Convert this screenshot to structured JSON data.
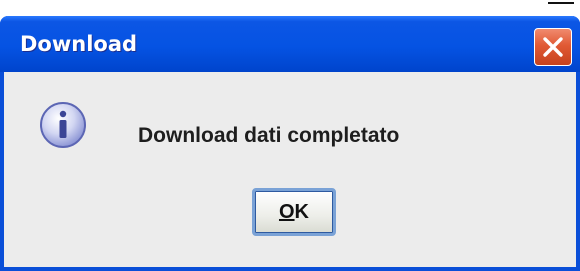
{
  "window": {
    "title": "Download"
  },
  "dialog": {
    "message": "Download dati completato",
    "ok_button": {
      "mnemonic": "O",
      "rest": "K"
    }
  },
  "icons": {
    "close": "close-icon",
    "info": "info-icon"
  },
  "colors": {
    "titlebar": "#0553e3",
    "window_border": "#0a4fd8",
    "close_button": "#e15a35",
    "dialog_background": "#ececec",
    "button_focus": "#7aa2d6"
  }
}
